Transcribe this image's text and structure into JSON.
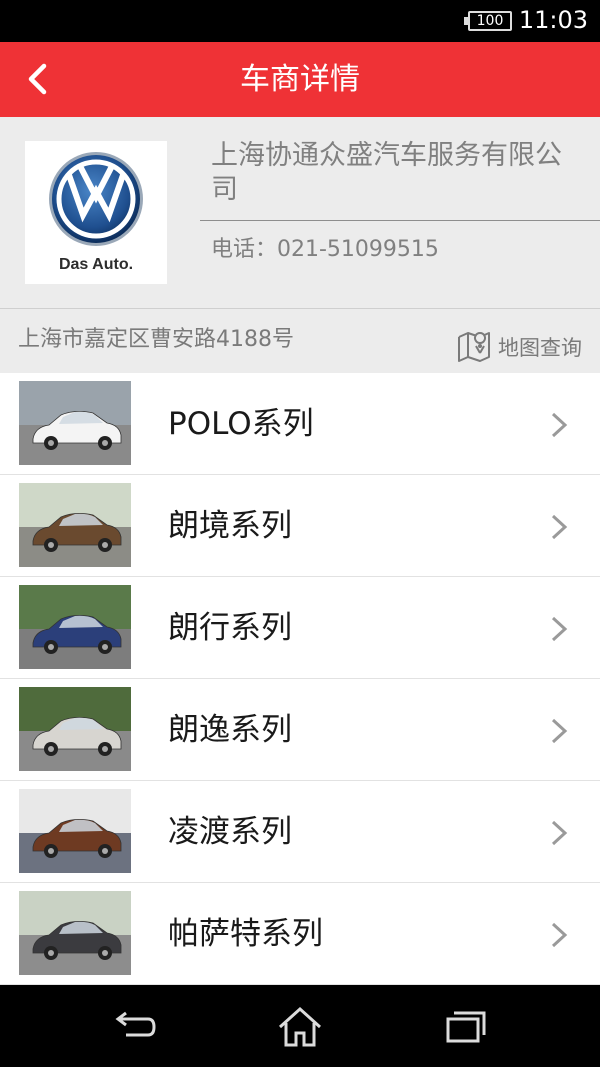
{
  "status_bar": {
    "battery": "100",
    "time": "11:03"
  },
  "header": {
    "title": "车商详情",
    "back_icon": "chevron-left-icon"
  },
  "dealer": {
    "logo_tag": "Das Auto.",
    "name": "上海协通众盛汽车服务有限公司",
    "phone": "电话：021-51099515",
    "address": "上海市嘉定区曹安路4188号",
    "map_label": "地图查询"
  },
  "series": [
    {
      "name": "POLO系列",
      "car_color": "#f4f4f4",
      "bg_top": "#9aa3ab",
      "bg_bottom": "#8a8a8a"
    },
    {
      "name": "朗境系列",
      "car_color": "#6a4a2f",
      "bg_top": "#cfd8c8",
      "bg_bottom": "#8c8c86"
    },
    {
      "name": "朗行系列",
      "car_color": "#2b3f7a",
      "bg_top": "#5a7a4a",
      "bg_bottom": "#7d7d7d"
    },
    {
      "name": "朗逸系列",
      "car_color": "#d7d5d0",
      "bg_top": "#4f6b3c",
      "bg_bottom": "#8a8a8a"
    },
    {
      "name": "凌渡系列",
      "car_color": "#6e3a22",
      "bg_top": "#e8e8e8",
      "bg_bottom": "#6c7280"
    },
    {
      "name": "帕萨特系列",
      "car_color": "#3b3b3f",
      "bg_top": "#c9d2c4",
      "bg_bottom": "#8d8d8d"
    }
  ],
  "colors": {
    "brand_red": "#ef3236",
    "card_bg": "#ececec"
  }
}
